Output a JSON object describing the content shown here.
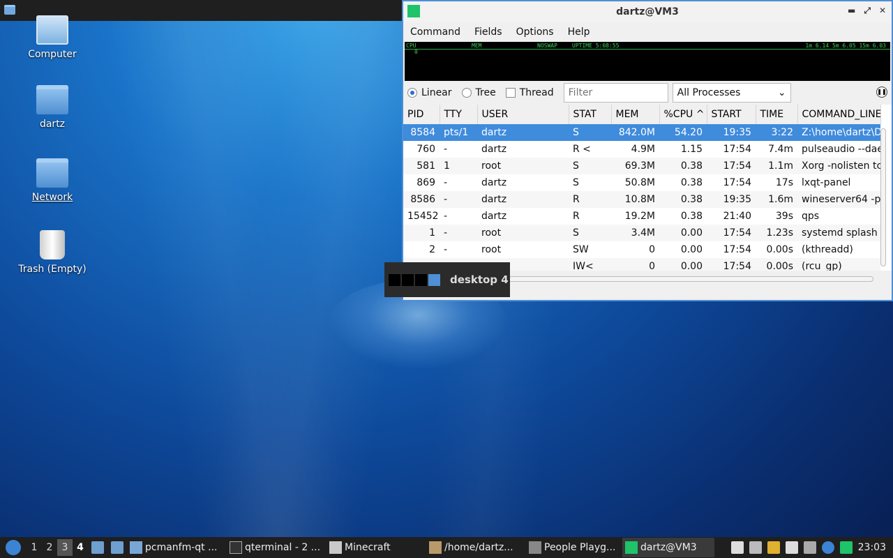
{
  "desktop": {
    "icons": [
      {
        "label": "Computer"
      },
      {
        "label": "dartz"
      },
      {
        "label": "Network"
      },
      {
        "label": "Trash (Empty)"
      }
    ]
  },
  "window": {
    "title": "dartz@VM3",
    "menu": [
      "Command",
      "Fields",
      "Options",
      "Help"
    ],
    "graph": {
      "left": "CPU",
      "mem": "MEM",
      "noswap": "NOSWAP",
      "uptime": "UPTIME 5:08:55",
      "load": "1m 6.14 5m 6.05 15m 6.03",
      "zero": "0"
    },
    "view_options": {
      "linear": "Linear",
      "tree": "Tree",
      "thread": "Thread"
    },
    "filter_placeholder": "Filter",
    "process_scope": "All Processes",
    "columns": [
      "PID",
      "TTY",
      "USER",
      "STAT",
      "MEM",
      "%CPU",
      "START",
      "TIME",
      "COMMAND_LINE"
    ],
    "sort_indicator": "^",
    "rows": [
      [
        "8584",
        "pts/1",
        "dartz",
        "S",
        "842.0M",
        "54.20",
        "19:35",
        "3:22",
        "Z:\\home\\dartz\\D"
      ],
      [
        "760",
        "-",
        "dartz",
        "R <",
        "4.9M",
        "1.15",
        "17:54",
        "7.4m",
        "pulseaudio --dae"
      ],
      [
        "581",
        "1",
        "root",
        "S",
        "69.3M",
        "0.38",
        "17:54",
        "1.1m",
        "Xorg -nolisten tc"
      ],
      [
        "869",
        "-",
        "dartz",
        "S",
        "50.8M",
        "0.38",
        "17:54",
        "17s",
        "lxqt-panel"
      ],
      [
        "8586",
        "-",
        "dartz",
        "R",
        "10.8M",
        "0.38",
        "19:35",
        "1.6m",
        "wineserver64 -p"
      ],
      [
        "15452",
        "-",
        "dartz",
        "R",
        "19.2M",
        "0.38",
        "21:40",
        "39s",
        "qps"
      ],
      [
        "1",
        "-",
        "root",
        "S",
        "3.4M",
        "0.00",
        "17:54",
        "1.23s",
        "systemd splash"
      ],
      [
        "2",
        "-",
        "root",
        "SW",
        "0",
        "0.00",
        "17:54",
        "0.00s",
        "(kthreadd)"
      ],
      [
        "",
        "",
        "",
        "IW<",
        "0",
        "0.00",
        "17:54",
        "0.00s",
        "(rcu_gp)"
      ]
    ]
  },
  "desktop_popup": {
    "label": "desktop 4"
  },
  "taskbar": {
    "workspaces": [
      "1",
      "2",
      "3",
      "4"
    ],
    "tasks": [
      "pcmanfm-qt ...",
      "qterminal - 2 ...",
      "Minecraft",
      "/home/dartz...",
      "People Playg...",
      "dartz@VM3"
    ],
    "clock": "23:03"
  },
  "colors": {
    "accent": "#3f8bdc",
    "window_border": "#4e8fd6",
    "app_icon": "#1ec36a",
    "taskbar": "#1f1f1f"
  }
}
